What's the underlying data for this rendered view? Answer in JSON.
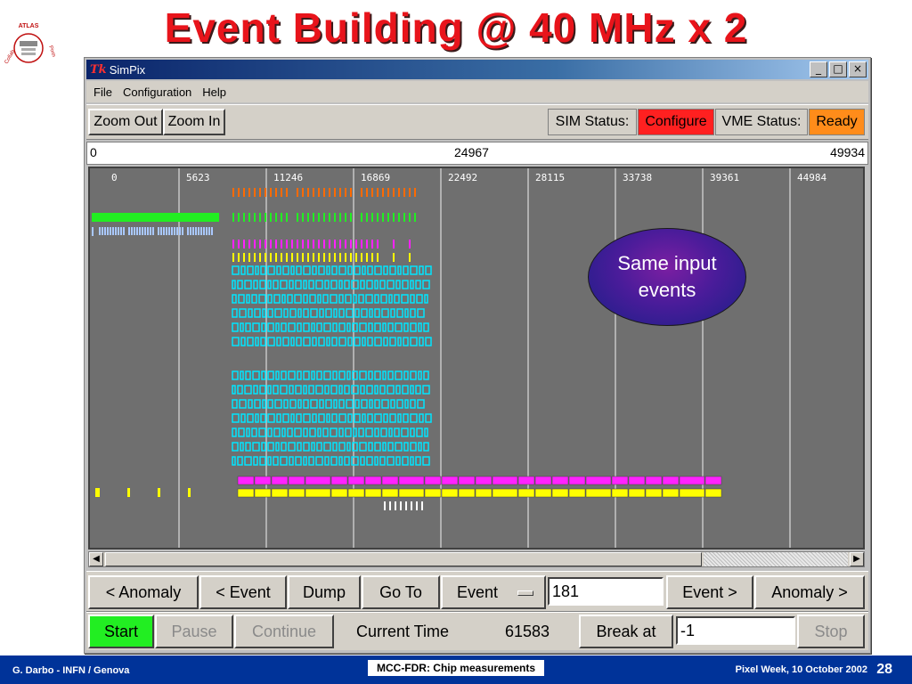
{
  "slide": {
    "title": "Event Building @ 40 MHz x 2",
    "logo_text": "ATLAS Pixel Detector Collaboration",
    "footer_left": "G. Darbo - INFN / Genova",
    "footer_center": "MCC-FDR: Chip measurements",
    "footer_right": "Pixel Week, 10 October 2002",
    "page_number": "28",
    "callout": "Same input events"
  },
  "window": {
    "app_icon": "Tk",
    "title": "SimPix",
    "controls": [
      "_",
      "□",
      "×"
    ]
  },
  "menu": [
    "File",
    "Configuration",
    "Help"
  ],
  "toolbar": {
    "zoom_out": "Zoom Out",
    "zoom_in": "Zoom In",
    "sim_status_label": "SIM Status:",
    "sim_status_value": "Configure",
    "sim_status_color": "#ff2020",
    "vme_status_label": "VME Status:",
    "vme_status_value": "Ready",
    "vme_status_color": "#ff8c1a"
  },
  "ruler": {
    "start": "0",
    "middle": "24967",
    "end": "49934"
  },
  "timeline": {
    "tick_labels": [
      "0",
      "5623",
      "11246",
      "16869",
      "22492",
      "28115",
      "33738",
      "39361",
      "44984"
    ],
    "colors": {
      "background": "#6f6f6f",
      "orange": "#ff6a00",
      "green": "#22ee22",
      "lightblue": "#a9c8ff",
      "magenta": "#ff22ff",
      "yellow": "#ffff00",
      "cyan": "#00e5ff",
      "white": "#ffffff"
    }
  },
  "controls_row1": {
    "prev_anomaly": "< Anomaly",
    "prev_event": "< Event",
    "dump": "Dump",
    "go_to": "Go To",
    "goto_mode": "Event",
    "goto_value": "181",
    "next_event": "Event >",
    "next_anomaly": "Anomaly >"
  },
  "controls_row2": {
    "start": "Start",
    "pause": "Pause",
    "continue": "Continue",
    "current_time_label": "Current Time",
    "current_time_value": "61583",
    "break_at": "Break at",
    "break_value": "-1",
    "stop": "Stop"
  }
}
